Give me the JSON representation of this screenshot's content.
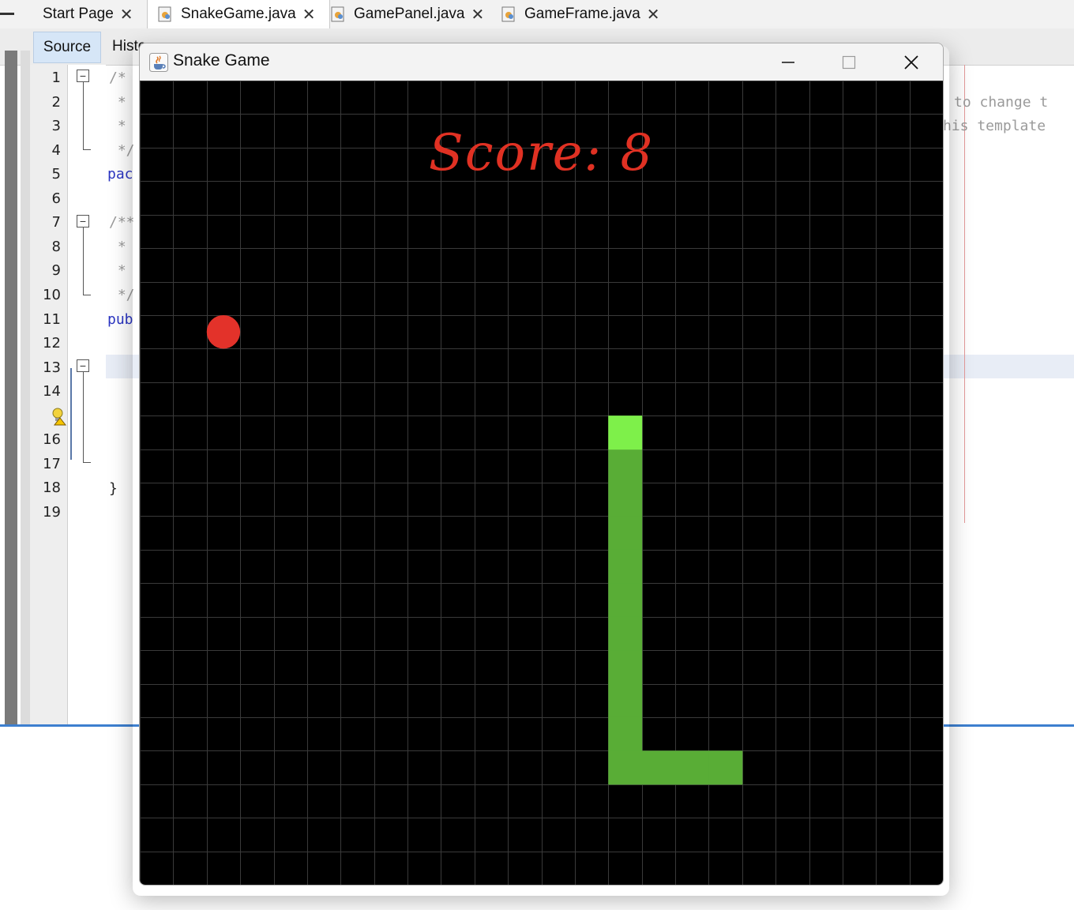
{
  "ide": {
    "tabs": [
      {
        "label": "Start Page",
        "has_icon": false
      },
      {
        "label": "SnakeGame.java",
        "has_icon": true,
        "active": true
      },
      {
        "label": "GamePanel.java",
        "has_icon": true
      },
      {
        "label": "GameFrame.java",
        "has_icon": true
      }
    ],
    "close_glyph": "✕",
    "source_label": "Source",
    "history_label": "Histo",
    "line_numbers": [
      "1",
      "2",
      "3",
      "4",
      "5",
      "6",
      "7",
      "8",
      "9",
      "10",
      "11",
      "12",
      "13",
      "14",
      "",
      "16",
      "17",
      "18",
      "19"
    ],
    "code_lines": {
      "l1": "/*",
      "l2": " *",
      "l3": " *",
      "l4": " */",
      "l5": "pac",
      "l7": "/**",
      "l8": " *",
      "l9": " *",
      "l10": " */",
      "l11": "pub",
      "l18": "}",
      "r2": "to change t",
      "r3": "his template"
    },
    "fold_glyph": "−"
  },
  "window": {
    "title": "Snake Game",
    "minimize_glyph": "—",
    "close_glyph": "✕"
  },
  "game": {
    "score_text": "Score: 8",
    "score": 8,
    "grid": {
      "cols": 24,
      "rows": 24
    },
    "colors": {
      "background": "#000000",
      "grid_line": "#3a3a3a",
      "apple": "#e3322a",
      "snake_head": "#7ef04a",
      "snake_body": "#59ad36",
      "score": "#e03123"
    },
    "apple": {
      "col": 2,
      "row": 7
    },
    "snake": {
      "head": [
        14,
        10
      ],
      "body": [
        [
          14,
          11
        ],
        [
          14,
          12
        ],
        [
          14,
          13
        ],
        [
          14,
          14
        ],
        [
          14,
          15
        ],
        [
          14,
          16
        ],
        [
          14,
          17
        ],
        [
          14,
          18
        ],
        [
          15,
          20
        ],
        [
          16,
          20
        ],
        [
          17,
          20
        ],
        [
          14,
          19
        ],
        [
          14,
          20
        ]
      ]
    }
  }
}
